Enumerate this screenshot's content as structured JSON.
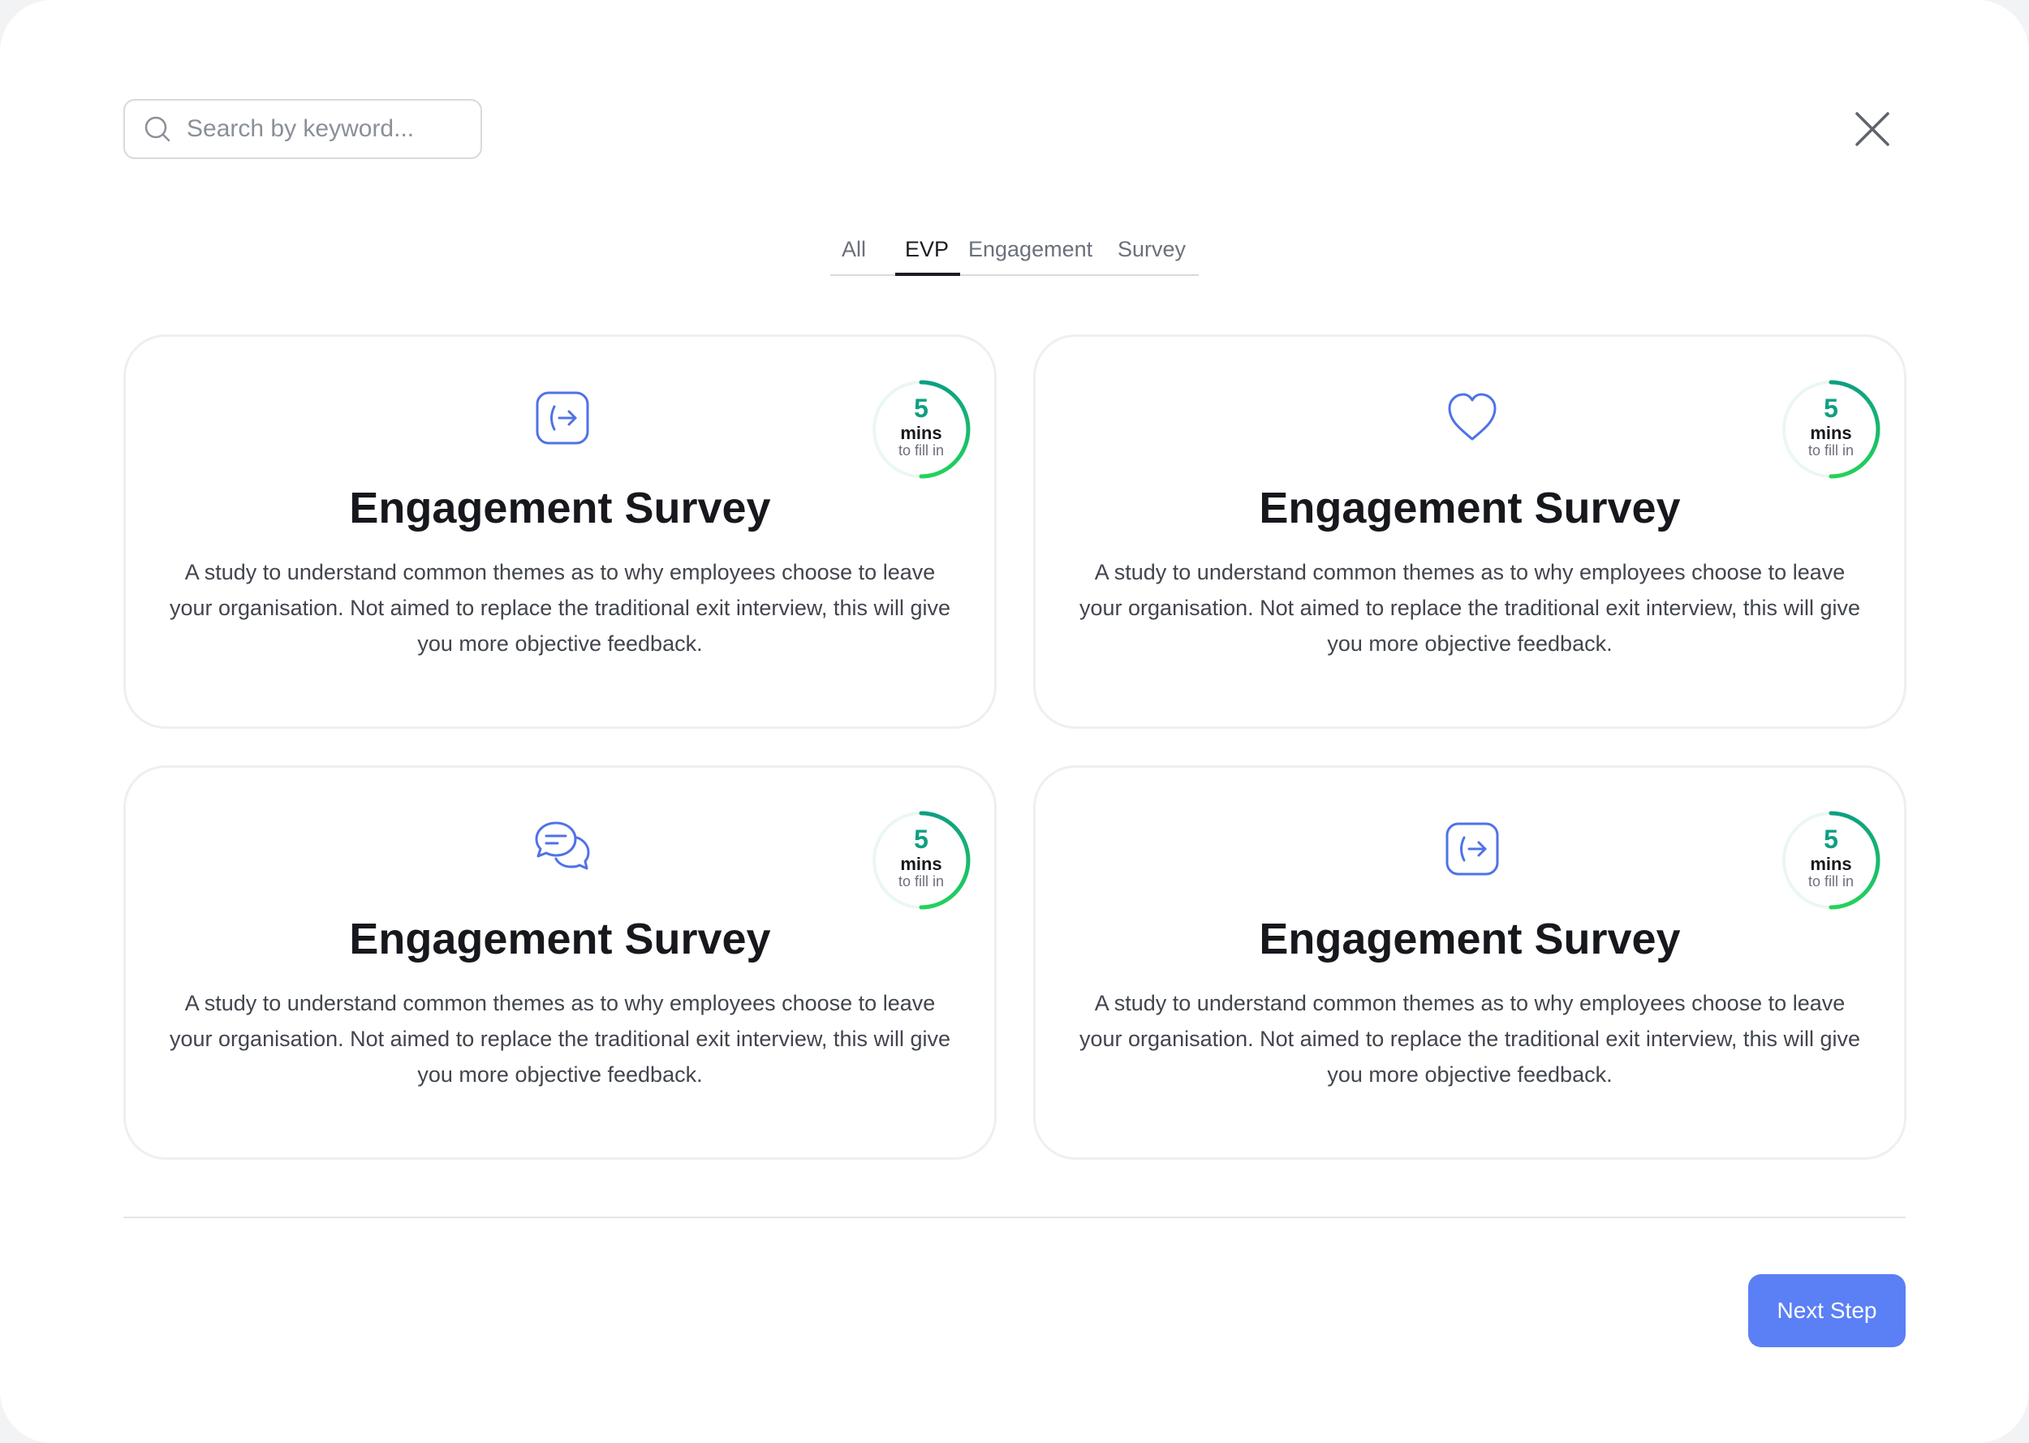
{
  "search": {
    "placeholder": "Search by keyword..."
  },
  "tabs": [
    {
      "label": "All"
    },
    {
      "label": "EVP"
    },
    {
      "label": "Engagement"
    },
    {
      "label": "Survey"
    }
  ],
  "active_tab": "EVP",
  "cards": [
    {
      "icon": "login-arrow-icon",
      "title": "Engagement Survey",
      "description": "A study to understand common themes as to why employees choose to leave your organisation. Not aimed to replace the traditional exit interview, this will give you more objective feedback.",
      "time_value": "5",
      "time_unit": "mins",
      "time_caption": "to fill in"
    },
    {
      "icon": "heart-icon",
      "title": "Engagement Survey",
      "description": "A study to understand common themes as to why employees choose to leave your organisation. Not aimed to replace the traditional exit interview, this will give you more objective feedback.",
      "time_value": "5",
      "time_unit": "mins",
      "time_caption": "to fill in"
    },
    {
      "icon": "chat-bubbles-icon",
      "title": "Engagement Survey",
      "description": "A study to understand common themes as to why employees choose to leave your organisation. Not aimed to replace the traditional exit interview, this will give you more objective feedback.",
      "time_value": "5",
      "time_unit": "mins",
      "time_caption": "to fill in"
    },
    {
      "icon": "login-arrow-icon",
      "title": "Engagement Survey",
      "description": "A study to understand common themes as to why employees choose to leave your organisation. Not aimed to replace the traditional exit interview, this will give you more objective feedback.",
      "time_value": "5",
      "time_unit": "mins",
      "time_caption": "to fill in"
    }
  ],
  "footer": {
    "next_label": "Next Step"
  },
  "colors": {
    "accent": "#5b7ff5",
    "timer_green": "#22c55e",
    "timer_teal": "#0e9f82",
    "icon_blue": "#4f72e8"
  }
}
